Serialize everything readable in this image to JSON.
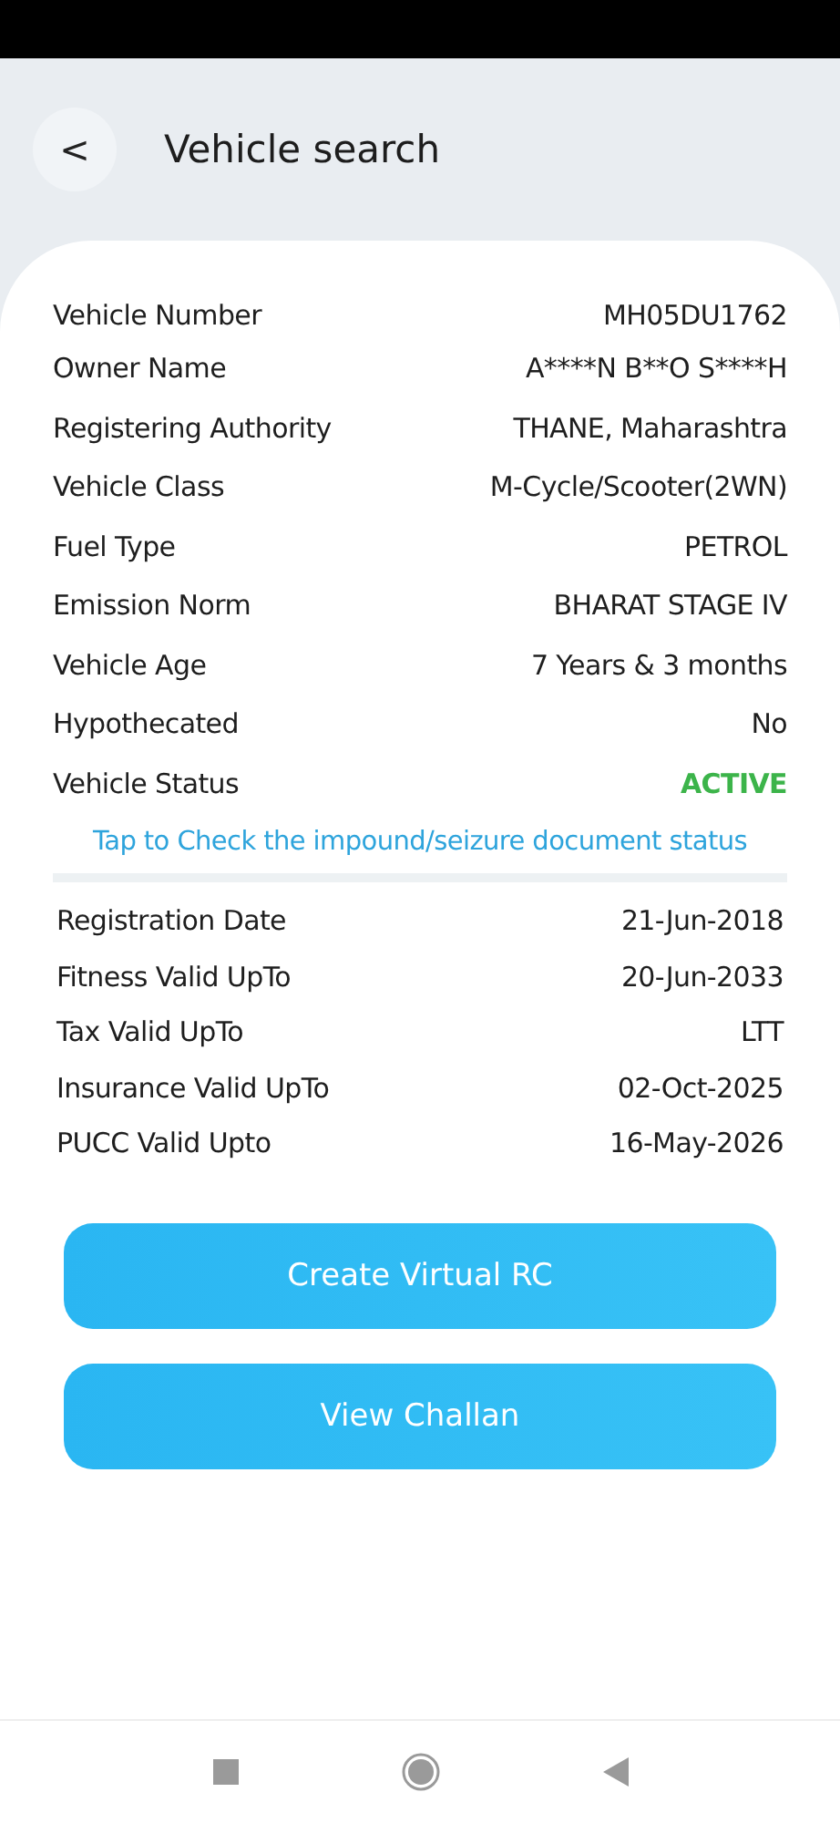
{
  "header": {
    "back": "<",
    "title": "Vehicle search"
  },
  "details": [
    {
      "label": "Vehicle Number",
      "value": "MH05DU1762",
      "highlighted": false
    },
    {
      "label": "Owner Name",
      "value": "A****N B**O S****H",
      "highlighted": false
    },
    {
      "label": "Registering Authority",
      "value": "THANE, Maharashtra",
      "highlighted": false
    },
    {
      "label": "Vehicle Class",
      "value": "M-Cycle/Scooter(2WN)",
      "highlighted": false
    },
    {
      "label": "Fuel Type",
      "value": "PETROL",
      "highlighted": false
    },
    {
      "label": "Emission Norm",
      "value": "BHARAT STAGE IV",
      "highlighted": false
    },
    {
      "label": "Vehicle Age",
      "value": "7 Years  & 3 months",
      "highlighted": false
    },
    {
      "label": "Hypothecated",
      "value": "No",
      "highlighted": false
    },
    {
      "label": "Vehicle Status",
      "value": "ACTIVE",
      "highlighted": true
    }
  ],
  "impound_link": "Tap to Check the impound/seizure document status",
  "validity": [
    {
      "label": "Registration Date",
      "value": "21-Jun-2018"
    },
    {
      "label": "Fitness Valid UpTo",
      "value": "20-Jun-2033"
    },
    {
      "label": "Tax Valid UpTo",
      "value": "LTT"
    },
    {
      "label": "Insurance Valid UpTo",
      "value": "02-Oct-2025"
    },
    {
      "label": "PUCC Valid Upto",
      "value": "16-May-2026"
    }
  ],
  "buttons": [
    "Create Virtual RC",
    "View Challan"
  ]
}
